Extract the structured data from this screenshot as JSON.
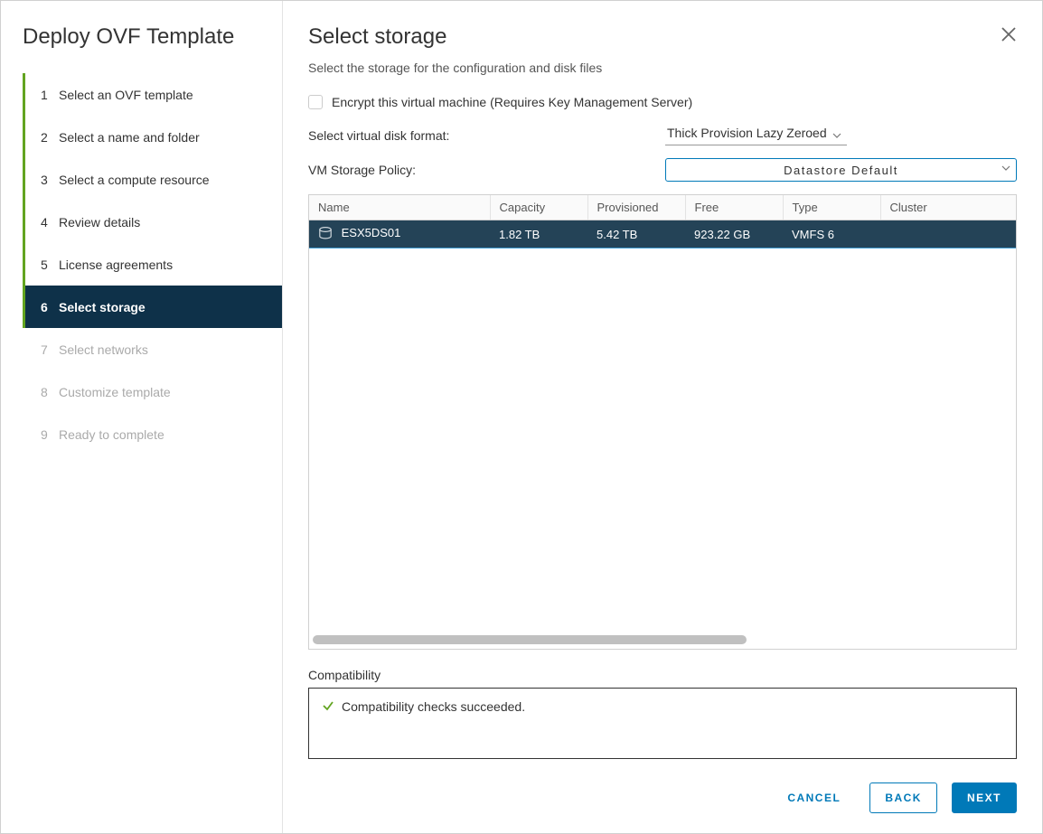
{
  "sidebar": {
    "title": "Deploy OVF Template",
    "steps": [
      {
        "num": "1",
        "label": "Select an OVF template",
        "state": "done"
      },
      {
        "num": "2",
        "label": "Select a name and folder",
        "state": "done"
      },
      {
        "num": "3",
        "label": "Select a compute resource",
        "state": "done"
      },
      {
        "num": "4",
        "label": "Review details",
        "state": "done"
      },
      {
        "num": "5",
        "label": "License agreements",
        "state": "done"
      },
      {
        "num": "6",
        "label": "Select storage",
        "state": "current"
      },
      {
        "num": "7",
        "label": "Select networks",
        "state": "future"
      },
      {
        "num": "8",
        "label": "Customize template",
        "state": "future"
      },
      {
        "num": "9",
        "label": "Ready to complete",
        "state": "future"
      }
    ]
  },
  "main": {
    "title": "Select storage",
    "subtitle": "Select the storage for the configuration and disk files",
    "encrypt_label": "Encrypt this virtual machine (Requires Key Management Server)",
    "disk_format_label": "Select virtual disk format:",
    "disk_format_value": "Thick Provision Lazy Zeroed",
    "vm_policy_label": "VM Storage Policy:",
    "vm_policy_value": "Datastore Default",
    "table": {
      "headers": {
        "name": "Name",
        "capacity": "Capacity",
        "provisioned": "Provisioned",
        "free": "Free",
        "type": "Type",
        "cluster": "Cluster"
      },
      "rows": [
        {
          "name": "ESX5DS01",
          "capacity": "1.82 TB",
          "provisioned": "5.42 TB",
          "free": "923.22 GB",
          "type": "VMFS 6",
          "cluster": ""
        }
      ]
    },
    "compat_label": "Compatibility",
    "compat_message": "Compatibility checks succeeded.",
    "buttons": {
      "cancel": "CANCEL",
      "back": "BACK",
      "next": "NEXT"
    }
  }
}
